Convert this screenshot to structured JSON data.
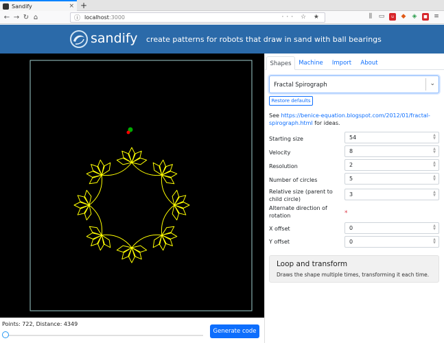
{
  "browser": {
    "tab_title": "Sandify",
    "tab_close": "×",
    "new_tab": "+",
    "url_host": "localhost",
    "url_port": ":3000",
    "url_actions": "··· ☆ ★",
    "nav": {
      "back": "←",
      "forward": "→",
      "reload": "↻",
      "home": "⌂"
    },
    "toolbar_icons": [
      "library-icon",
      "reader-icon",
      "ublock-icon",
      "extension-icon",
      "lastpass-icon",
      "extension-icon-2",
      "menu-icon"
    ]
  },
  "header": {
    "brand": "sandify",
    "tagline": "create patterns for robots that draw in sand with ball bearings",
    "accent": "#2b6aa9"
  },
  "preview": {
    "background": "#000000",
    "frame_color": "#9fd1d1",
    "stroke_color": "#ffff00",
    "start_marker_color": "#00aa00",
    "end_marker_color": "#ff0000"
  },
  "footer": {
    "stats": "Points: 722, Distance: 4349",
    "generate_label": "Generate code",
    "slider_value": 0
  },
  "panel": {
    "tabs": [
      {
        "label": "Shapes",
        "active": true
      },
      {
        "label": "Machine",
        "active": false
      },
      {
        "label": "Import",
        "active": false
      },
      {
        "label": "About",
        "active": false
      }
    ],
    "shape_select": "Fractal Spirograph",
    "restore_label": "Restore defaults",
    "see_prefix": "See ",
    "see_link": "https://benice-equation.blogspot.com/2012/01/fractal-spirograph.html",
    "see_suffix": " for ideas.",
    "fields": [
      {
        "label": "Starting size",
        "value": "54"
      },
      {
        "label": "Velocity",
        "value": "8"
      },
      {
        "label": "Resolution",
        "value": "2"
      },
      {
        "label": "Number of circles",
        "value": "5"
      },
      {
        "label": "Relative size (parent to child circle)",
        "value": "3"
      },
      {
        "label": "Alternate direction of rotation",
        "value": "",
        "checkbox": true,
        "checked": false
      },
      {
        "label": "X offset",
        "value": "0"
      },
      {
        "label": "Y offset",
        "value": "0"
      }
    ],
    "required_mark": "*",
    "loop": {
      "title": "Loop and transform",
      "desc": "Draws the shape multiple times, transforming it each time."
    }
  }
}
